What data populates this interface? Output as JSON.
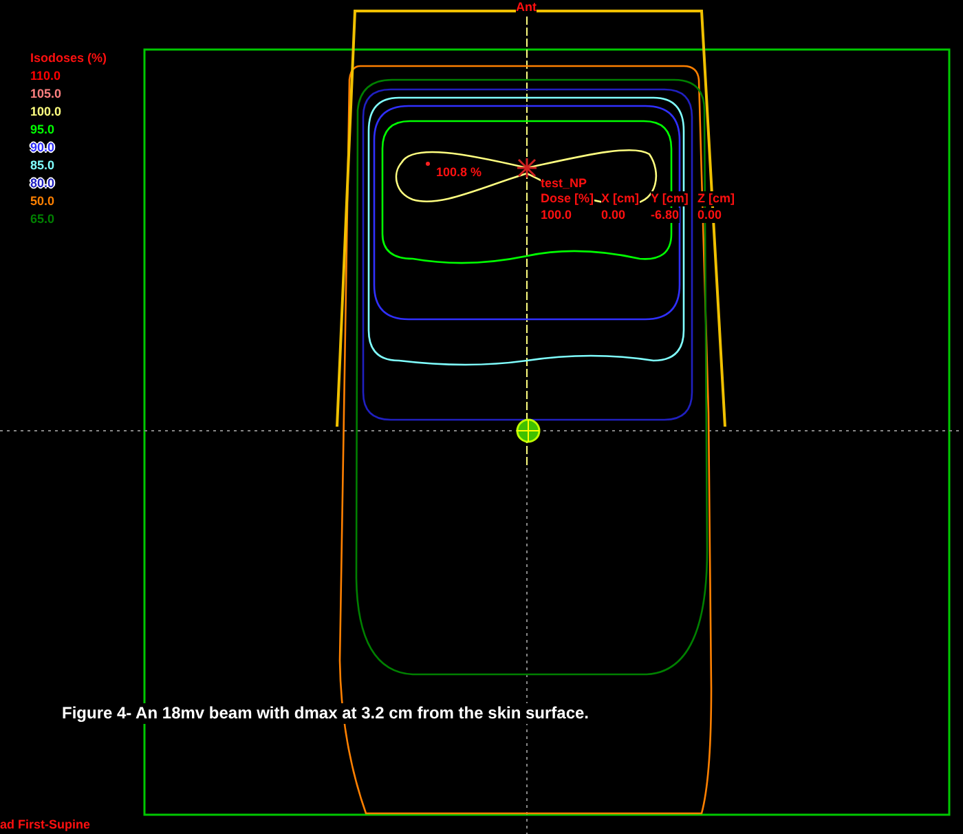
{
  "orientation_label": "Ant",
  "legend": {
    "title": "Isodoses (%)",
    "items": [
      {
        "label": "110.0",
        "color": "#ff0000",
        "outlined": false
      },
      {
        "label": "105.0",
        "color": "#ff8080",
        "outlined": false
      },
      {
        "label": "100.0",
        "color": "#ffff80",
        "outlined": false
      },
      {
        "label": "95.0",
        "color": "#00ff00",
        "outlined": false
      },
      {
        "label": "90.0",
        "color": "#3030ff",
        "outlined": true
      },
      {
        "label": "85.0",
        "color": "#80ffff",
        "outlined": false
      },
      {
        "label": "80.0",
        "color": "#2020c0",
        "outlined": true
      },
      {
        "label": "50.0",
        "color": "#ff8000",
        "outlined": false
      },
      {
        "label": "65.0",
        "color": "#008000",
        "outlined": false
      }
    ]
  },
  "max_point": {
    "label": "100.8 %"
  },
  "reference_point": {
    "name": "test_NP",
    "headers": [
      "Dose [%]",
      "X [cm]",
      "Y [cm]",
      "Z [cm]"
    ],
    "values": [
      "100.0",
      "0.00",
      "-6.80",
      "0.00"
    ]
  },
  "caption": "Figure 4- An 18mv beam with dmax at 3.2 cm from the skin surface.",
  "patient_orientation": "ad First-Supine"
}
